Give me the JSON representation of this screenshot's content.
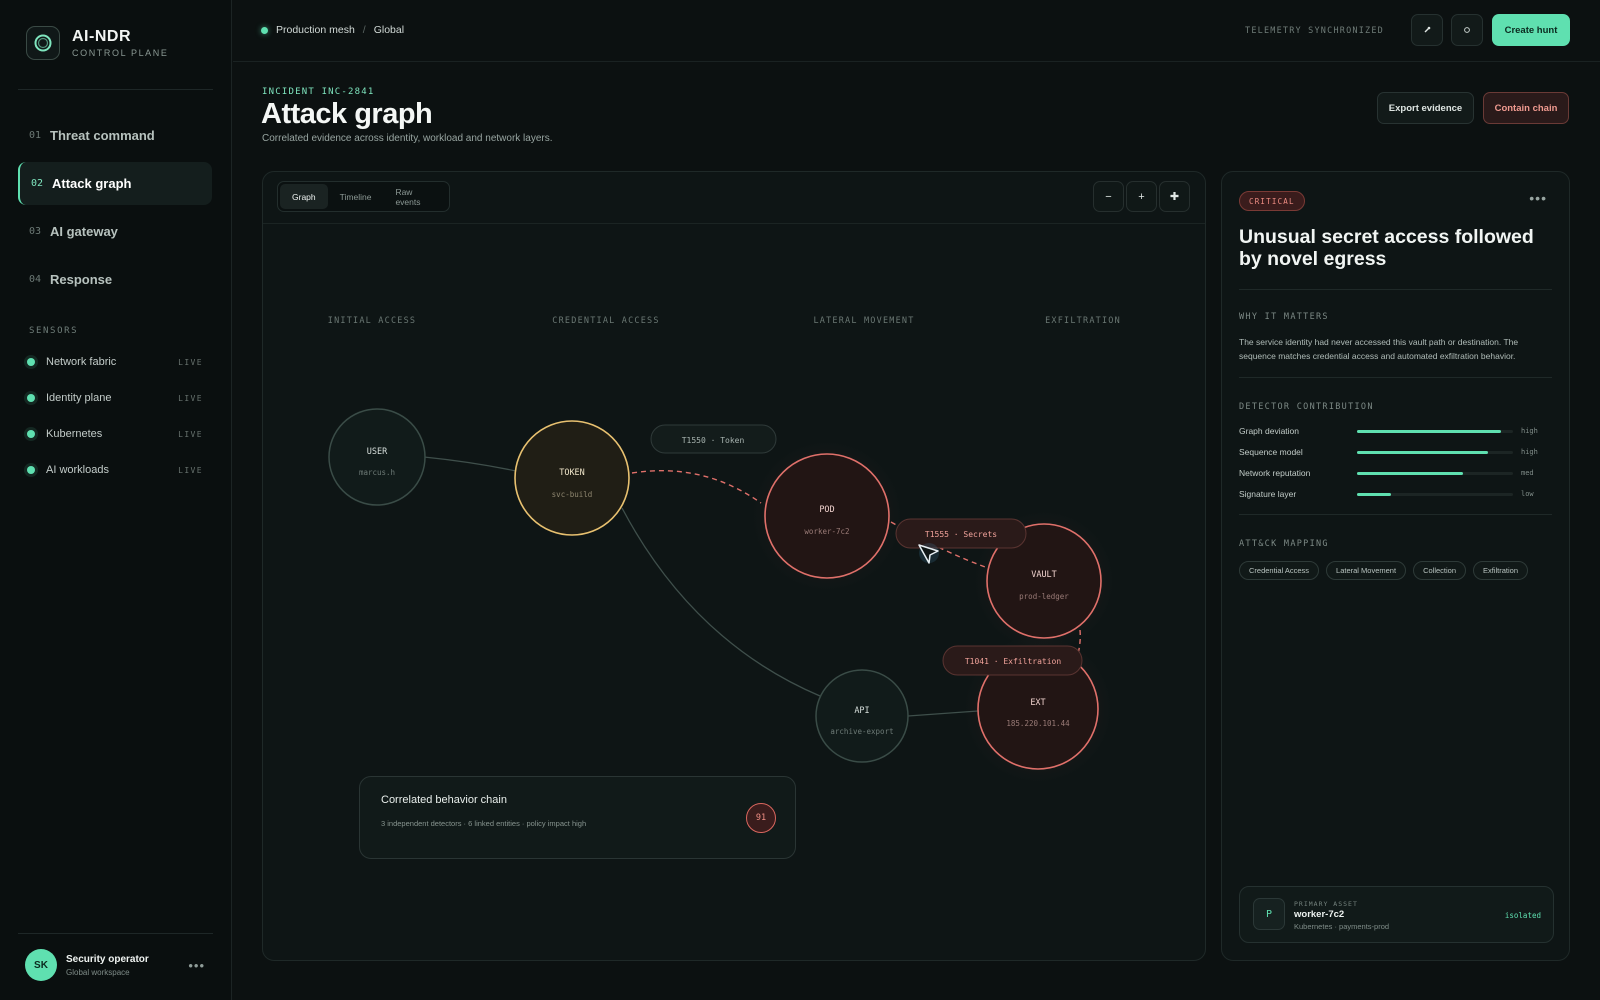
{
  "brand": {
    "name": "AI-NDR",
    "subtitle": "CONTROL PLANE"
  },
  "nav": [
    {
      "num": "01",
      "label": "Threat command",
      "active": false
    },
    {
      "num": "02",
      "label": "Attack graph",
      "active": true
    },
    {
      "num": "03",
      "label": "AI gateway",
      "active": false
    },
    {
      "num": "04",
      "label": "Response",
      "active": false
    }
  ],
  "sensors": {
    "title": "SENSORS",
    "items": [
      {
        "name": "Network fabric",
        "status": "LIVE"
      },
      {
        "name": "Identity plane",
        "status": "LIVE"
      },
      {
        "name": "Kubernetes",
        "status": "LIVE"
      },
      {
        "name": "AI workloads",
        "status": "LIVE"
      }
    ]
  },
  "user": {
    "initials": "SK",
    "name": "Security operator",
    "workspace": "Global workspace",
    "menu": "•••"
  },
  "topbar": {
    "crumb1": "Production mesh",
    "separator": "/",
    "crumb2": "Global",
    "telemetry": "TELEMETRY SYNCHRONIZED",
    "create_hunt": "Create hunt"
  },
  "header": {
    "incident": "INCIDENT INC-2841",
    "title": "Attack graph",
    "subtitle": "Correlated evidence across identity, workload and network layers.",
    "export": "Export evidence",
    "contain": "Contain chain"
  },
  "graph": {
    "tabs": [
      "Graph",
      "Timeline",
      "Raw events"
    ],
    "zoom": {
      "out": "−",
      "in": "+",
      "fit": "✚"
    },
    "phases": [
      "INITIAL ACCESS",
      "CREDENTIAL ACCESS",
      "LATERAL MOVEMENT",
      "EXFILTRATION"
    ],
    "nodes": [
      {
        "id": "user",
        "label": "USER",
        "sub": "marcus.h",
        "kind": "neutral"
      },
      {
        "id": "token",
        "label": "TOKEN",
        "sub": "svc-build",
        "kind": "warn"
      },
      {
        "id": "pod",
        "label": "POD",
        "sub": "worker-7c2",
        "kind": "crit"
      },
      {
        "id": "vault",
        "label": "VAULT",
        "sub": "prod-ledger",
        "kind": "crit"
      },
      {
        "id": "api",
        "label": "API",
        "sub": "archive-export",
        "kind": "neutral"
      },
      {
        "id": "ext",
        "label": "EXT",
        "sub": "185.220.101.44",
        "kind": "crit"
      }
    ],
    "edge_labels": [
      {
        "text": "T1550 · Token",
        "kind": "neutral"
      },
      {
        "text": "T1555 · Secrets",
        "kind": "crit"
      },
      {
        "text": "T1041 · Exfiltration",
        "kind": "crit"
      }
    ],
    "correlation": {
      "title": "Correlated behavior chain",
      "meta": "3 independent detectors · 6 linked entities · policy impact high",
      "score": "91"
    },
    "colors": {
      "neutral_stroke": "#3a4c47",
      "warn_stroke": "#e8c170",
      "crit_stroke": "#e0706a",
      "edge_gray": "#3f4f4b",
      "edge_red": "#e0706a"
    }
  },
  "detail": {
    "severity": "CRITICAL",
    "menu": "•••",
    "title": "Unusual secret access followed by novel egress",
    "why_title": "WHY IT MATTERS",
    "why_text": "The service identity had never accessed this vault path or destination. The sequence matches credential access and automated exfiltration behavior.",
    "detector_title": "DETECTOR CONTRIBUTION",
    "detectors": [
      {
        "name": "Graph deviation",
        "level": "high",
        "score": 0.92
      },
      {
        "name": "Sequence model",
        "level": "high",
        "score": 0.84
      },
      {
        "name": "Network reputation",
        "level": "med",
        "score": 0.68
      },
      {
        "name": "Signature layer",
        "level": "low",
        "score": 0.22
      }
    ],
    "attack_title": "ATT&CK MAPPING",
    "attack_tags": [
      "Credential Access",
      "Lateral Movement",
      "Collection",
      "Exfiltration"
    ],
    "asset": {
      "initial": "P",
      "label": "PRIMARY ASSET",
      "name": "worker-7c2",
      "meta": "Kubernetes · payments-prod",
      "status": "isolated"
    }
  }
}
